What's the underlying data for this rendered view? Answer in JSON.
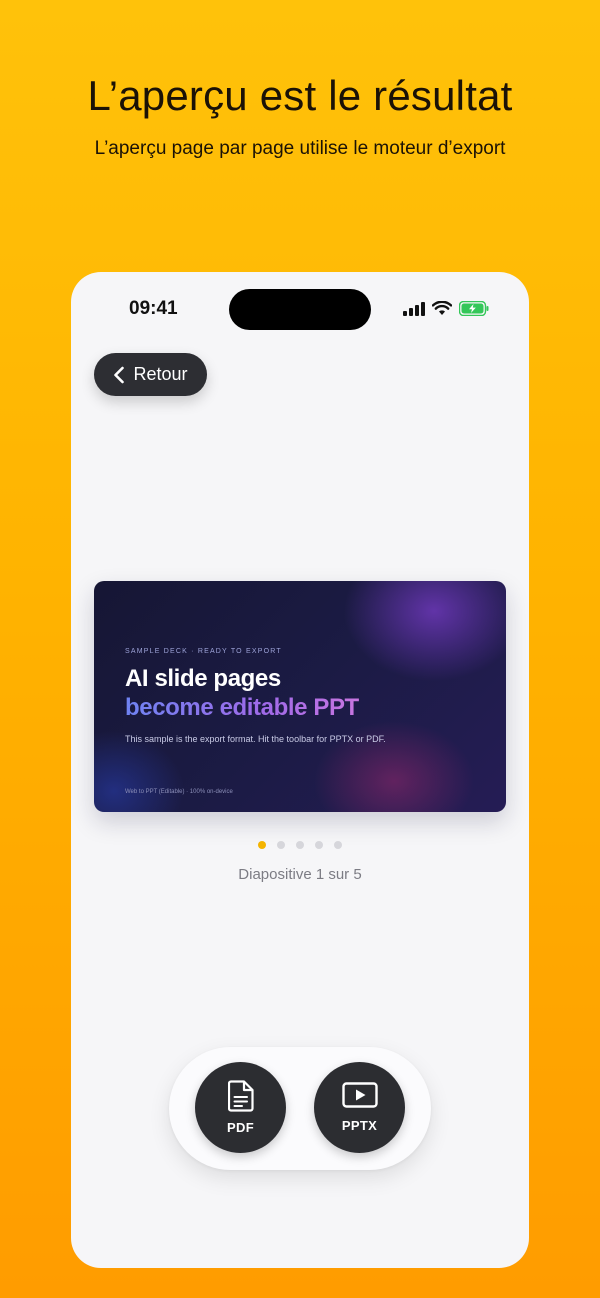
{
  "header": {
    "title": "L’aperçu est le résultat",
    "subtitle": "L’aperçu page par page utilise le moteur d’export"
  },
  "status_bar": {
    "time": "09:41",
    "icons": [
      "signal-icon",
      "wifi-icon",
      "battery-charging-icon"
    ],
    "battery_color": "#34c759"
  },
  "nav": {
    "back_label": "Retour"
  },
  "slide": {
    "kicker": "SAMPLE DECK · READY TO EXPORT",
    "title_line1": "AI slide pages",
    "title_line2": "become editable PPT",
    "body": "This sample is the export format. Hit the toolbar for PPTX or PDF.",
    "footer": "Web to PPT (Editable) · 100% on-device"
  },
  "pager": {
    "count": 5,
    "active_index": 0,
    "label": "Diapositive 1 sur 5",
    "active_color": "#f4b400"
  },
  "toolbar": {
    "pdf_label": "PDF",
    "pptx_label": "PPTX"
  },
  "colors": {
    "background_top": "#ffc20a",
    "background_bottom": "#ff9c00",
    "button_dark": "#2c2d31"
  }
}
